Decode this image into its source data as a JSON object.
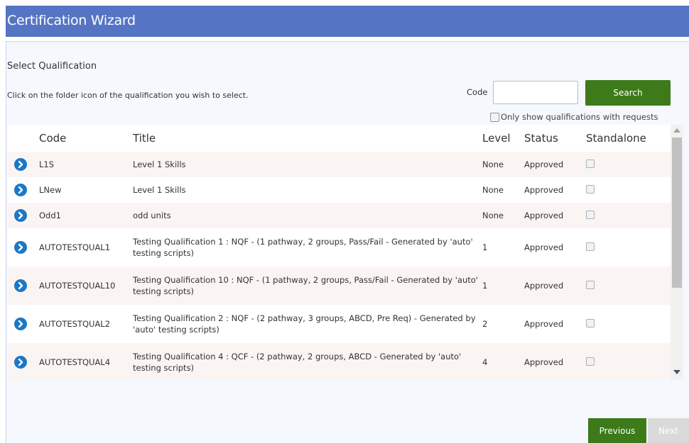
{
  "window": {
    "title": "Certification Wizard"
  },
  "section": {
    "title": "Select Qualification",
    "instruction": "Click on the folder icon of the qualification you wish to select."
  },
  "search": {
    "code_label": "Code",
    "code_value": "",
    "button_label": "Search",
    "filter_label": "Only show qualifications with requests",
    "filter_checked": false
  },
  "table": {
    "columns": [
      "Code",
      "Title",
      "Level",
      "Status",
      "Standalone"
    ],
    "rows": [
      {
        "code": "L1S",
        "title": "Level 1 Skills",
        "level": "None",
        "status": "Approved",
        "standalone": false
      },
      {
        "code": "LNew",
        "title": "Level 1 Skills",
        "level": "None",
        "status": "Approved",
        "standalone": false
      },
      {
        "code": "Odd1",
        "title": "odd units",
        "level": "None",
        "status": "Approved",
        "standalone": false
      },
      {
        "code": "AUTOTESTQUAL1",
        "title": "Testing Qualification 1 : NQF - (1 pathway, 2 groups, Pass/Fail - Generated by 'auto' testing scripts)",
        "level": "1",
        "status": "Approved",
        "standalone": false
      },
      {
        "code": "AUTOTESTQUAL10",
        "title": "Testing Qualification 10 : NQF - (1 pathway, 2 groups, Pass/Fail - Generated by 'auto' testing scripts)",
        "level": "1",
        "status": "Approved",
        "standalone": false
      },
      {
        "code": "AUTOTESTQUAL2",
        "title": "Testing Qualification 2 : NQF - (2 pathway, 3 groups, ABCD, Pre Req) - Generated by 'auto' testing scripts)",
        "level": "2",
        "status": "Approved",
        "standalone": false
      },
      {
        "code": "AUTOTESTQUAL4",
        "title": "Testing Qualification 4 : QCF - (2 pathway, 2 groups, ABCD - Generated by 'auto' testing scripts)",
        "level": "4",
        "status": "Approved",
        "standalone": false
      }
    ]
  },
  "footer": {
    "previous_label": "Previous",
    "next_label": "Next"
  },
  "colors": {
    "header_bg": "#5674c4",
    "button_green": "#3d7a1a",
    "arrow_blue": "#1b78c7",
    "disabled_button": "#dadada"
  },
  "icons": {
    "row_select": "circle-chevron-right-icon"
  }
}
